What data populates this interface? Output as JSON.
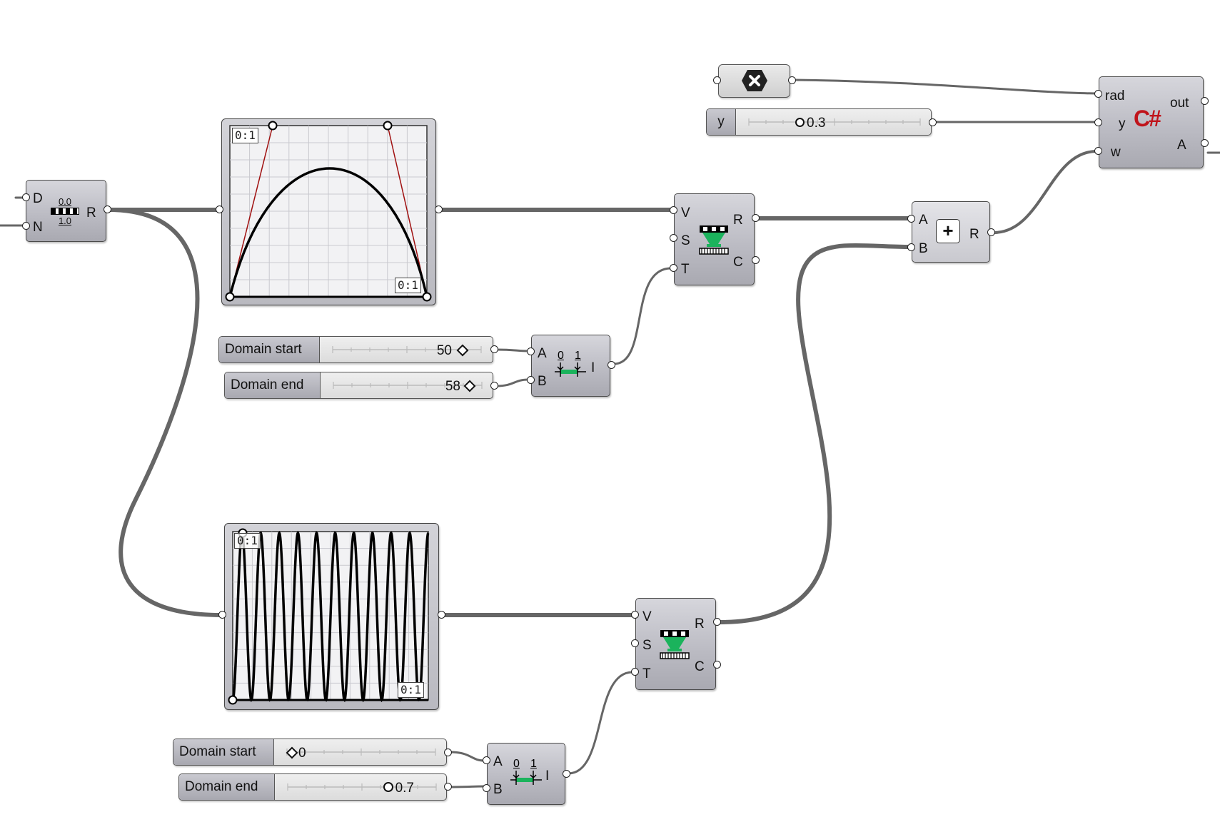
{
  "remap": {
    "inputs": [
      "D",
      "N"
    ],
    "output": "R",
    "icon_top": "0.0",
    "icon_bottom": "1.0"
  },
  "graph1": {
    "tag_top": "0:1",
    "tag_bottom": "0:1"
  },
  "graph2": {
    "tag_top": "0:1",
    "tag_bottom": "0:1"
  },
  "eval1": {
    "inputs": [
      "V",
      "S",
      "T"
    ],
    "outputs": [
      "R",
      "C"
    ]
  },
  "eval2": {
    "inputs": [
      "V",
      "S",
      "T"
    ],
    "outputs": [
      "R",
      "C"
    ]
  },
  "construct1": {
    "inputs": [
      "A",
      "B"
    ],
    "output": "I",
    "icon_a": "0",
    "icon_b": "1"
  },
  "construct2": {
    "inputs": [
      "A",
      "B"
    ],
    "output": "I",
    "icon_a": "0",
    "icon_b": "1"
  },
  "slider_start1": {
    "name": "Domain start",
    "value": "50"
  },
  "slider_end1": {
    "name": "Domain end",
    "value": "58"
  },
  "slider_start2": {
    "name": "Domain start",
    "value": "0"
  },
  "slider_end2": {
    "name": "Domain end",
    "value": "0.7"
  },
  "slider_y": {
    "name": "y",
    "value": "0.3"
  },
  "addition": {
    "inputs": [
      "A",
      "B"
    ],
    "output": "R",
    "icon": "+"
  },
  "csharp": {
    "inputs": [
      "rad",
      "y",
      "w"
    ],
    "outputs": [
      "out",
      "A"
    ],
    "icon": "C#"
  },
  "toggle": {
    "icon": "close-icon"
  }
}
